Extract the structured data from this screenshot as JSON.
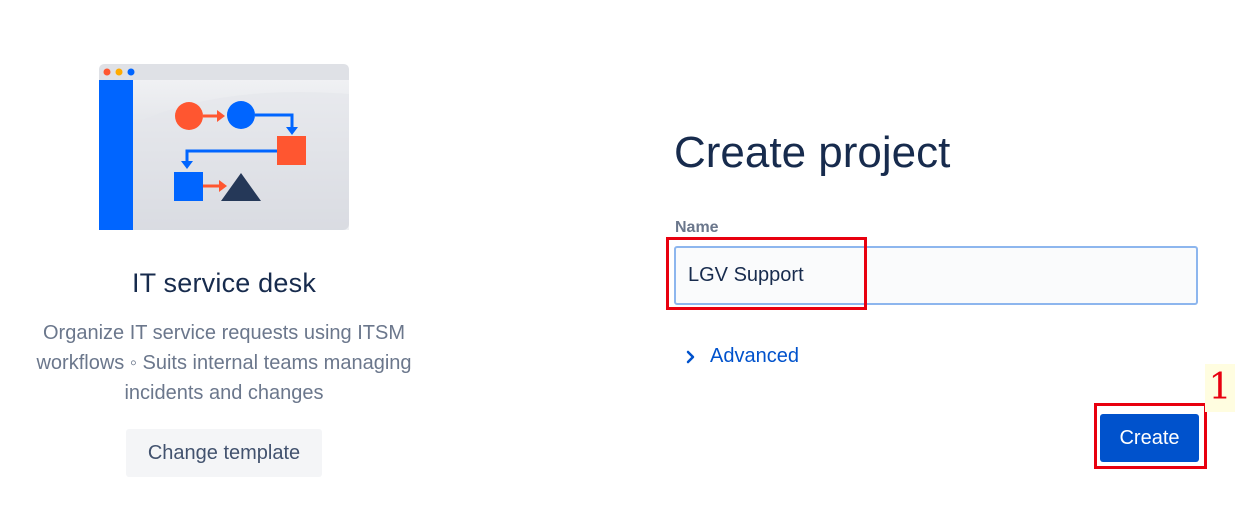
{
  "template": {
    "title": "IT service desk",
    "description": "Organize IT service requests using ITSM workflows ◦ Suits internal teams managing incidents and changes",
    "change_button_label": "Change template",
    "illustration_icon": "workflow-illustration"
  },
  "form": {
    "heading": "Create project",
    "name_label": "Name",
    "name_value": "LGV Support",
    "advanced_label": "Advanced",
    "create_button_label": "Create"
  },
  "annotation": {
    "marker_number": "1"
  },
  "colors": {
    "primary": "#0052cc",
    "heading_text": "#172b4d",
    "muted_text": "#6b778c",
    "annotation_red": "#e8000f",
    "shape_orange": "#ff5630",
    "shape_blue": "#0065ff",
    "shape_navy": "#253858"
  }
}
